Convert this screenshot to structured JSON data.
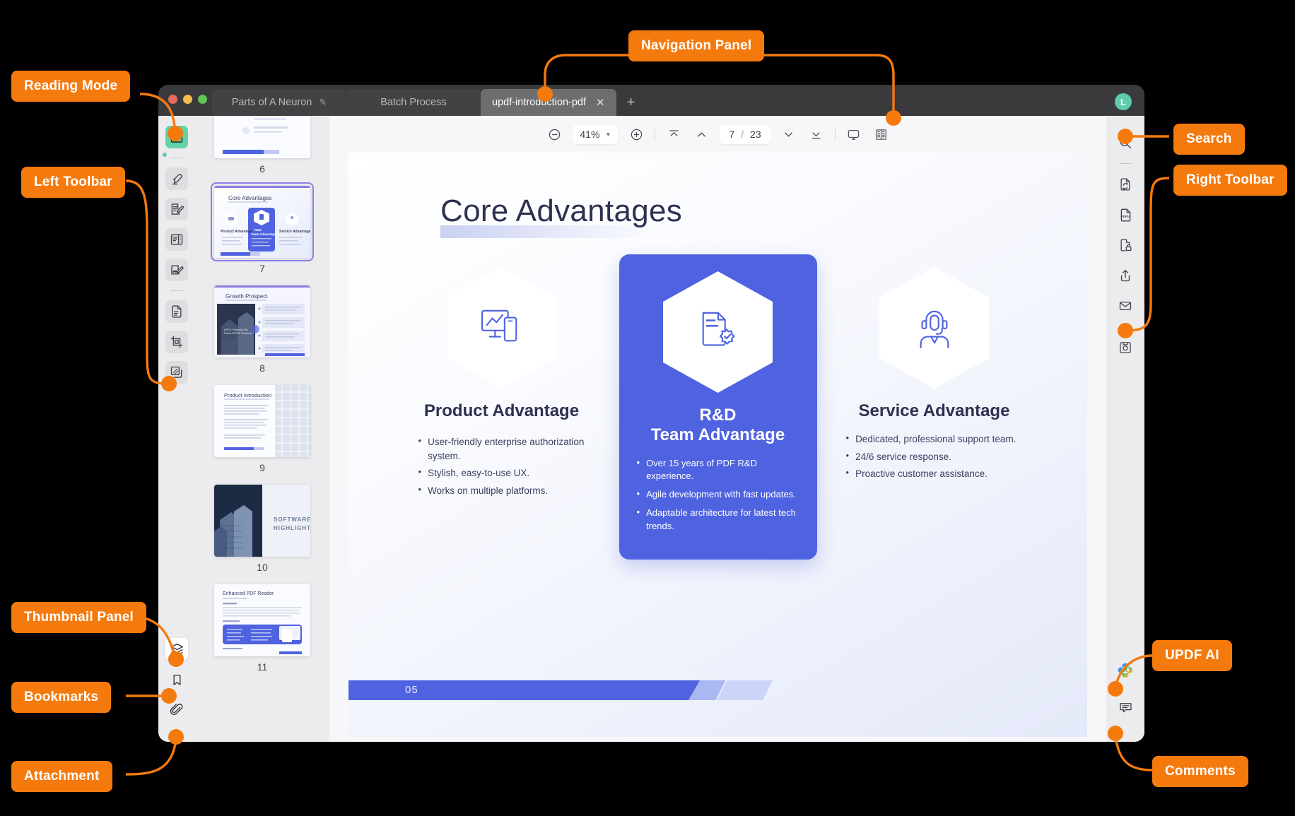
{
  "callouts": [
    {
      "id": "reading-mode",
      "label": "Reading Mode"
    },
    {
      "id": "left-toolbar",
      "label": "Left Toolbar"
    },
    {
      "id": "thumbnail-panel",
      "label": "Thumbnail Panel"
    },
    {
      "id": "bookmarks",
      "label": "Bookmarks"
    },
    {
      "id": "attachment",
      "label": "Attachment"
    },
    {
      "id": "navigation-panel",
      "label": "Navigation Panel"
    },
    {
      "id": "search",
      "label": "Search"
    },
    {
      "id": "right-toolbar",
      "label": "Right Toolbar"
    },
    {
      "id": "updf-ai",
      "label": "UPDF AI"
    },
    {
      "id": "comments",
      "label": "Comments"
    }
  ],
  "accent_color": "#F57A0E",
  "window": {
    "avatar_initial": "L",
    "tabs": [
      {
        "label": "Parts of A Neuron",
        "active": false,
        "has_pen": true,
        "has_close": false
      },
      {
        "label": "Batch Process",
        "active": false,
        "has_pen": false,
        "has_close": false
      },
      {
        "label": "updf-introduction-pdf",
        "active": true,
        "has_pen": false,
        "has_close": true
      }
    ],
    "new_tab_label": "+"
  },
  "toolbar": {
    "zoom_out_label": "−",
    "zoom_value": "41%",
    "zoom_in_label": "+",
    "first_page_title": "First Page",
    "prev_page_title": "Previous Page",
    "current_page": "7",
    "separator": "/",
    "total_pages": "23",
    "next_page_title": "Next Page",
    "last_page_title": "Last Page",
    "presentation_title": "Presentation",
    "view_mode_title": "View Settings"
  },
  "left_rail": {
    "items": [
      {
        "name": "reading-mode-icon",
        "state": "green"
      },
      {
        "name": "divider"
      },
      {
        "name": "highlighter-icon",
        "state": "shaded"
      },
      {
        "name": "edit-text-icon",
        "state": "shaded"
      },
      {
        "name": "organize-pages-icon",
        "state": "shaded"
      },
      {
        "name": "annotate-icon",
        "state": "shaded"
      },
      {
        "name": "divider"
      },
      {
        "name": "page-convert-icon",
        "state": "shaded"
      },
      {
        "name": "crop-icon",
        "state": "shaded"
      },
      {
        "name": "batch-icon",
        "state": "shaded"
      }
    ],
    "bottom_items": [
      {
        "name": "thumbnail-panel-icon",
        "state": "white"
      },
      {
        "name": "bookmark-icon",
        "state": "plain"
      },
      {
        "name": "attachment-icon",
        "state": "plain"
      }
    ]
  },
  "right_rail": {
    "items": [
      {
        "name": "search-icon"
      },
      {
        "name": "divider"
      },
      {
        "name": "convert-pdf-icon"
      },
      {
        "name": "pdfa-icon"
      },
      {
        "name": "protect-icon"
      },
      {
        "name": "share-icon"
      },
      {
        "name": "email-icon"
      },
      {
        "name": "divider"
      },
      {
        "name": "save-as-icon"
      }
    ],
    "bottom_items": [
      {
        "name": "updf-ai-icon"
      },
      {
        "name": "comments-icon"
      }
    ]
  },
  "thumbnails": [
    {
      "page": "6",
      "title": "",
      "selected": false,
      "kind": "slide-generic"
    },
    {
      "page": "7",
      "title": "Core Advantages",
      "selected": true,
      "kind": "core-advantages"
    },
    {
      "page": "8",
      "title": "Growth Prospect",
      "selected": false,
      "kind": "growth-prospect",
      "caption": "UPDF: Powering The Future Of PDF Solutions"
    },
    {
      "page": "9",
      "title": "Product Introduction",
      "selected": false,
      "kind": "product-intro"
    },
    {
      "page": "10",
      "title": "SOFTWARE HIGHLIGHTS",
      "selected": false,
      "kind": "software-highlights"
    },
    {
      "page": "11",
      "title": "Enhanced PDF Reader",
      "selected": false,
      "kind": "enhanced-reader"
    }
  ],
  "document_page": {
    "title": "Core Advantages",
    "footer_number": "05",
    "columns": [
      {
        "id": "product-advantage",
        "icon": "monitor-chart-mobile-icon",
        "title": "Product Advantage",
        "highlighted": false,
        "bullets": [
          "User-friendly enterprise authorization system.",
          "Stylish, easy-to-use UX.",
          "Works on multiple platforms."
        ]
      },
      {
        "id": "rd-team-advantage",
        "icon": "document-verified-icon",
        "title": "R&D\nTeam Advantage",
        "title_line1": "R&D",
        "title_line2": "Team Advantage",
        "highlighted": true,
        "bullets": [
          "Over 15 years of PDF R&D experience.",
          "Agile development with fast updates.",
          "Adaptable architecture for latest tech trends."
        ]
      },
      {
        "id": "service-advantage",
        "icon": "headset-support-icon",
        "title": "Service Advantage",
        "highlighted": false,
        "bullets": [
          "Dedicated, professional support team.",
          "24/6 service response.",
          "Proactive customer assistance."
        ]
      }
    ]
  }
}
